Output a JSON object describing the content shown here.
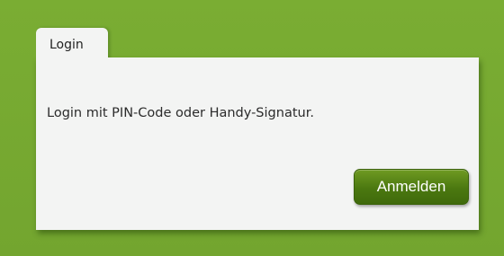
{
  "tab": {
    "label": "Login"
  },
  "panel": {
    "message": "Login mit PIN-Code oder Handy-Signatur.",
    "button_label": "Anmelden"
  },
  "colors": {
    "background": "#76a831",
    "panel": "#f3f4f3",
    "button": "#4b7810"
  }
}
